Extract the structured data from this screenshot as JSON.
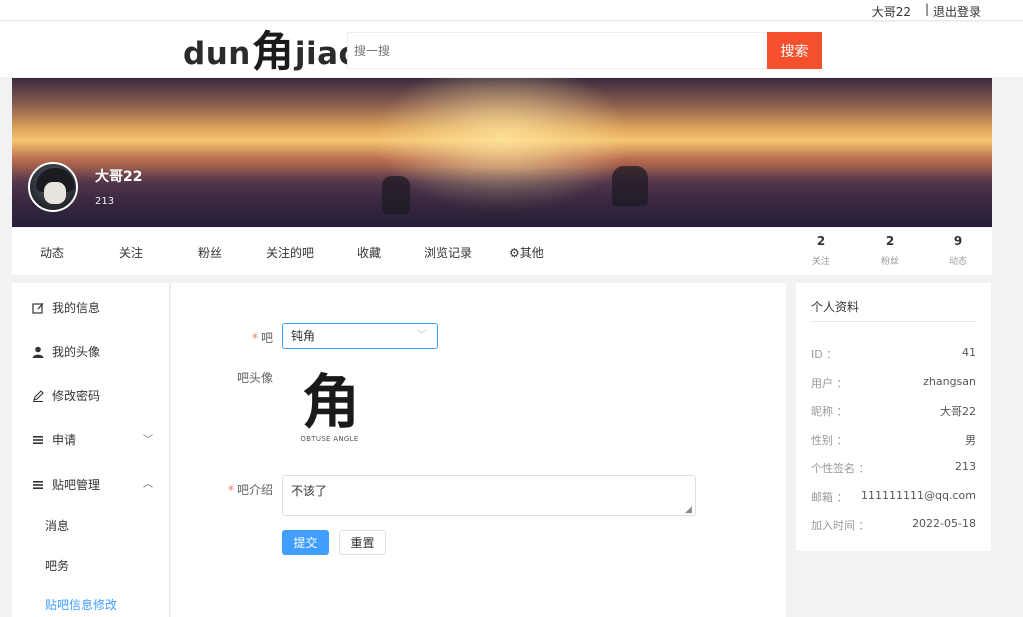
{
  "topbar": {
    "username": "大哥22",
    "separator": "|",
    "logout": "退出登录"
  },
  "header": {
    "logo": {
      "part1": "dun",
      "glyph": "角",
      "part2": "jiao"
    },
    "search": {
      "placeholder": "搜一搜",
      "button": "搜索"
    },
    "colors": {
      "search_button": "#f4502c"
    }
  },
  "banner": {
    "name": "大哥22",
    "subtitle": "213"
  },
  "nav": {
    "items": [
      "动态",
      "关注",
      "粉丝",
      "关注的吧",
      "收藏",
      "浏览记录",
      "⚙其他"
    ],
    "stats": [
      {
        "num": "2",
        "label": "关注"
      },
      {
        "num": "2",
        "label": "粉丝"
      },
      {
        "num": "9",
        "label": "动态"
      }
    ]
  },
  "sidebar": {
    "items": [
      {
        "label": "我的信息",
        "icon": "edit-icon"
      },
      {
        "label": "我的头像",
        "icon": "user-icon"
      },
      {
        "label": "修改密码",
        "icon": "pen-icon"
      },
      {
        "label": "申请",
        "icon": "list-icon",
        "chevron": "﹀"
      },
      {
        "label": "贴吧管理",
        "icon": "list-icon",
        "chevron": "︿"
      }
    ],
    "subitems": [
      "消息",
      "吧务",
      "贴吧信息修改"
    ],
    "active_color": "#409eff"
  },
  "form": {
    "bar_label": "吧",
    "bar_value": "钝角",
    "avatar_label": "吧头像",
    "avatar_glyph": "角",
    "avatar_caption": "OBTUSE ANGLE",
    "intro_label": "吧介绍",
    "intro_value": "不该了",
    "required_mark": "*",
    "submit": "提交",
    "reset": "重置"
  },
  "profile": {
    "title": "个人资料",
    "rows": [
      {
        "k": "ID ：",
        "v": "41"
      },
      {
        "k": "用户 ：",
        "v": "zhangsan"
      },
      {
        "k": "昵称 ：",
        "v": "大哥22"
      },
      {
        "k": "性别 ：",
        "v": "男"
      },
      {
        "k": "个性签名 ：",
        "v": "213"
      },
      {
        "k": "邮箱 ：",
        "v": "111111111@qq.com"
      },
      {
        "k": "加入时间 ：",
        "v": "2022-05-18"
      }
    ]
  }
}
